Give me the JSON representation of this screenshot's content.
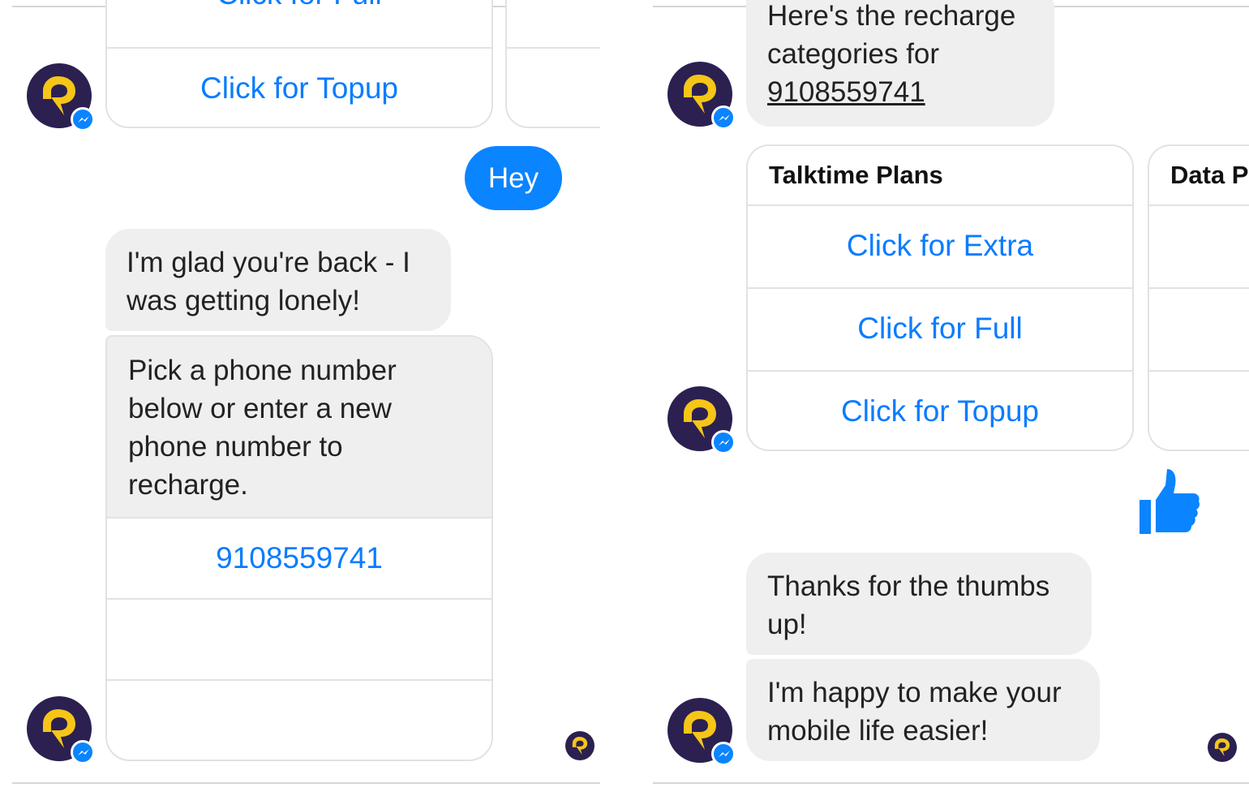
{
  "left": {
    "prev_card": {
      "button_partial": "Click for Full",
      "button_topup": "Click for Topup"
    },
    "sent_message": "Hey",
    "bot_greeting": "I'm glad you're back - I was getting lonely!",
    "bot_prompt": "Pick a phone number below or enter a new phone number to recharge.",
    "phone_option": "9108559741"
  },
  "right": {
    "intro_message": "Here's the recharge categories for ",
    "intro_number": "9108559741",
    "card1": {
      "title": "Talktime Plans",
      "buttons": [
        "Click for Extra",
        "Click for Full",
        "Click for Topup"
      ]
    },
    "card2": {
      "title_partial": "Data P"
    },
    "thumbs_icon": "thumbs-up-icon",
    "reply1": "Thanks for the thumbs up!",
    "reply2": "I'm happy to make your mobile life easier!"
  },
  "colors": {
    "messenger_blue": "#0a84ff",
    "link_blue": "#0a7cff",
    "bubble_gray": "#efefef",
    "avatar_bg": "#2b2050",
    "logo_yellow": "#f5c518"
  },
  "icons": [
    "bot-avatar-icon",
    "messenger-badge-icon",
    "read-receipt-avatar-icon",
    "thumbs-up-icon"
  ]
}
